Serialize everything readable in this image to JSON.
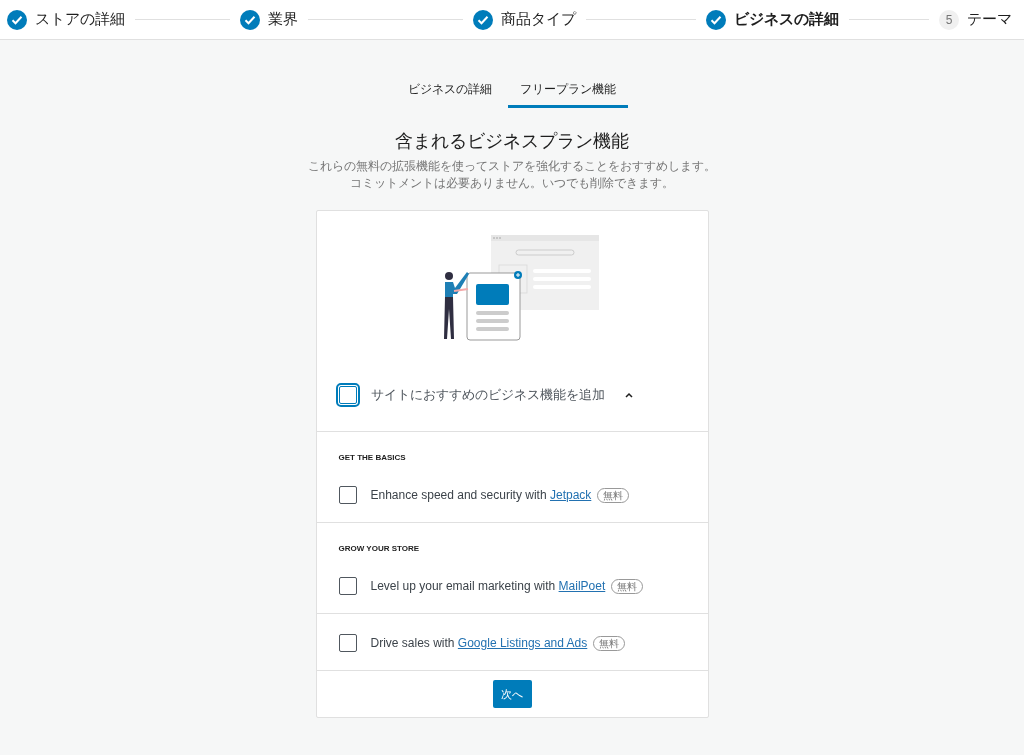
{
  "steps": [
    {
      "label": "ストアの詳細",
      "done": true,
      "selected": false
    },
    {
      "label": "業界",
      "done": true,
      "selected": false
    },
    {
      "label": "商品タイプ",
      "done": true,
      "selected": false
    },
    {
      "label": "ビジネスの詳細",
      "done": true,
      "selected": true
    },
    {
      "label": "テーマ",
      "number": "5",
      "done": false,
      "selected": false
    }
  ],
  "tabs": [
    {
      "label": "ビジネスの詳細",
      "selected": false
    },
    {
      "label": "フリープラン機能",
      "selected": true
    }
  ],
  "heading": "含まれるビジネスプラン機能",
  "subtitle": [
    "これらの無料の拡張機能を使ってストアを強化することをおすすめします。",
    "コミットメントは必要ありません。いつでも削除できます。"
  ],
  "master": {
    "label": "サイトにおすすめのビジネス機能を追加",
    "checked": false,
    "expanded": true
  },
  "groups": [
    {
      "heading": "GET THE BASICS",
      "items": [
        {
          "text": "Enhance speed and security with ",
          "link": "Jetpack",
          "badge": "無料",
          "checked": false
        }
      ]
    },
    {
      "heading": "GROW YOUR STORE",
      "items": [
        {
          "text": "Level up your email marketing with ",
          "link": "MailPoet",
          "badge": "無料",
          "checked": false
        }
      ]
    },
    {
      "items": [
        {
          "text": "Drive sales with ",
          "link": "Google Listings and Ads",
          "badge": "無料",
          "checked": false
        }
      ]
    }
  ],
  "next_button": "次へ"
}
